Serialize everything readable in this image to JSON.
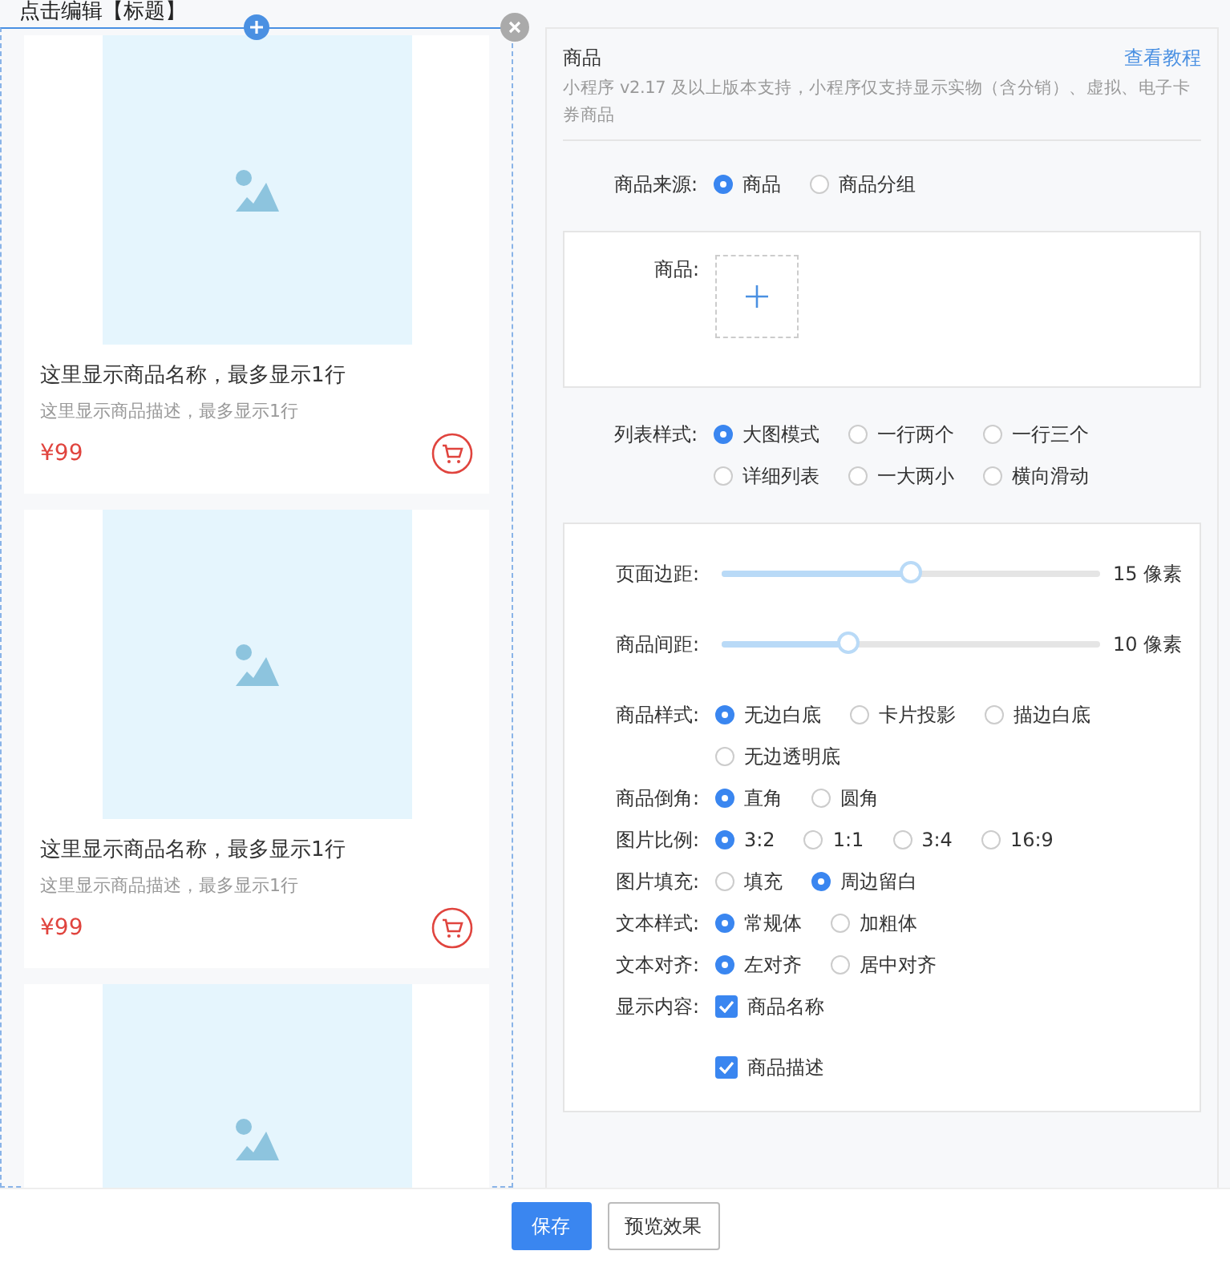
{
  "preview": {
    "title": "点击编辑【标题】",
    "products": [
      {
        "kind": "product",
        "name": "这里显示商品名称，最多显示1行",
        "description": "这里显示商品描述，最多显示1行",
        "price": "¥99"
      },
      {
        "kind": "product",
        "name": "这里显示商品名称，最多显示1行",
        "description": "这里显示商品描述，最多显示1行",
        "price": "¥99"
      },
      {
        "kind": "picture"
      }
    ]
  },
  "settings": {
    "title": "商品",
    "help_link": "查看教程",
    "note": "小程序 v2.17 及以上版本支持，小程序仅支持显示实物（含分销）、虚拟、电子卡券商品",
    "sections": [
      {
        "boxed": false,
        "rows": [
          {
            "kind": "radio",
            "label": "商品来源:",
            "options": [
              {
                "label": "商品",
                "selected": true
              },
              {
                "label": "商品分组",
                "selected": false
              }
            ]
          }
        ]
      },
      {
        "boxed": true,
        "rows": [
          {
            "kind": "picker",
            "label": "商品:"
          }
        ]
      },
      {
        "boxed": false,
        "rows": [
          {
            "kind": "radio",
            "label": "列表样式:",
            "options": [
              {
                "label": "大图模式",
                "selected": true
              },
              {
                "label": "一行两个",
                "selected": false
              },
              {
                "label": "一行三个",
                "selected": false
              },
              {
                "label": "详细列表",
                "selected": false
              },
              {
                "label": "一大两小",
                "selected": false
              },
              {
                "label": "横向滑动",
                "selected": false
              }
            ]
          }
        ]
      },
      {
        "boxed": true,
        "rows": [
          {
            "kind": "slider",
            "label": "页面边距:",
            "level": 0.5,
            "reading": "15 像素"
          },
          {
            "kind": "slider",
            "label": "商品间距:",
            "level": 0.335,
            "reading": "10 像素"
          },
          {
            "kind": "radio",
            "label": "商品样式:",
            "options": [
              {
                "label": "无边白底",
                "selected": true
              },
              {
                "label": "卡片投影",
                "selected": false
              },
              {
                "label": "描边白底",
                "selected": false
              },
              {
                "label": "无边透明底",
                "selected": false
              }
            ]
          },
          {
            "kind": "radio",
            "label": "商品倒角:",
            "options": [
              {
                "label": "直角",
                "selected": true
              },
              {
                "label": "圆角",
                "selected": false
              }
            ]
          },
          {
            "kind": "radio",
            "label": "图片比例:",
            "options": [
              {
                "label": "3:2",
                "selected": true
              },
              {
                "label": "1:1",
                "selected": false
              },
              {
                "label": "3:4",
                "selected": false
              },
              {
                "label": "16:9",
                "selected": false
              }
            ]
          },
          {
            "kind": "radio",
            "label": "图片填充:",
            "options": [
              {
                "label": "填充",
                "selected": false
              },
              {
                "label": "周边留白",
                "selected": true
              }
            ]
          },
          {
            "kind": "radio",
            "label": "文本样式:",
            "options": [
              {
                "label": "常规体",
                "selected": true
              },
              {
                "label": "加粗体",
                "selected": false
              }
            ]
          },
          {
            "kind": "radio",
            "label": "文本对齐:",
            "options": [
              {
                "label": "左对齐",
                "selected": true
              },
              {
                "label": "居中对齐",
                "selected": false
              }
            ]
          },
          {
            "kind": "checkbox",
            "label": "显示内容:",
            "options": [
              {
                "label": "商品名称",
                "checked": true
              },
              {
                "label": "商品描述",
                "checked": true
              }
            ]
          }
        ]
      }
    ]
  },
  "buttons": [
    {
      "label": "保存",
      "kind": "primary"
    },
    {
      "label": "预览效果",
      "kind": "default"
    }
  ]
}
